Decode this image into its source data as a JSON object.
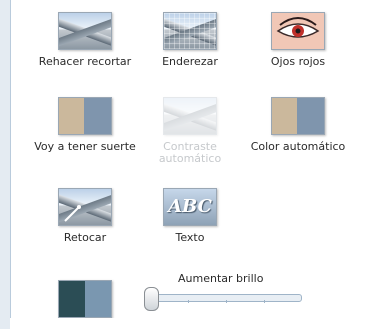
{
  "tools": [
    {
      "label": "Rehacer recortar",
      "icon": "crop-redo-icon"
    },
    {
      "label": "Enderezar",
      "icon": "straighten-icon"
    },
    {
      "label": "Ojos rojos",
      "icon": "red-eye-icon"
    },
    {
      "label": "Voy a tener suerte",
      "icon": "lucky-icon"
    },
    {
      "label": "Contraste automático",
      "icon": "auto-contrast-icon"
    },
    {
      "label": "Color automático",
      "icon": "auto-color-icon"
    },
    {
      "label": "Retocar",
      "icon": "retouch-icon"
    },
    {
      "label": "Texto",
      "icon": "text-icon"
    }
  ],
  "brightness": {
    "label": "Aumentar brillo",
    "value": 0.0,
    "icon": "brightness-icon"
  },
  "text_thumb": "ABC",
  "colors": {
    "panel_bg": "#ffffff",
    "sidebar": "#e4ebf2",
    "accent": "#b9cbdc"
  }
}
